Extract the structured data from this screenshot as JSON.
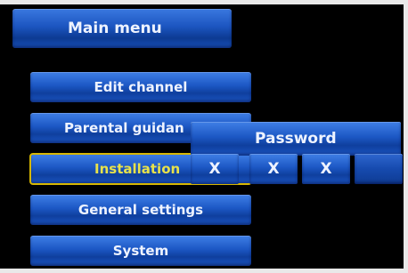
{
  "menu": {
    "title": "Main menu",
    "items": [
      {
        "label": "Edit channel"
      },
      {
        "label": "Parental guidan"
      },
      {
        "label": "Installation"
      },
      {
        "label": "General settings"
      },
      {
        "label": "System"
      }
    ],
    "selected_index": 2
  },
  "password_dialog": {
    "title": "Password",
    "fields": [
      {
        "value": "X"
      },
      {
        "value": "X"
      },
      {
        "value": "X"
      },
      {
        "value": ""
      }
    ]
  },
  "colors": {
    "menu_blue": "#1c57c4",
    "selection_border": "#d7b700",
    "selected_text": "#e8e24a",
    "background": "#000000"
  }
}
